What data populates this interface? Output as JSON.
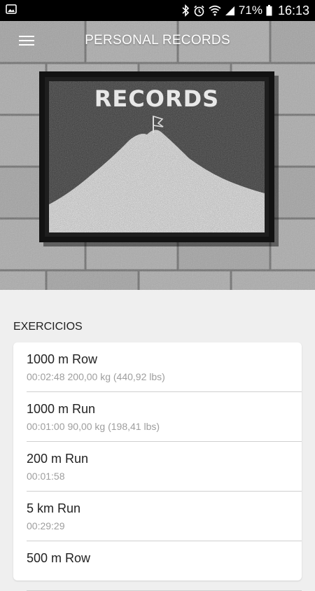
{
  "status_bar": {
    "battery": "71%",
    "time": "16:13",
    "icons": [
      "image-icon",
      "bluetooth-icon",
      "alarm-icon",
      "wifi-icon",
      "signal-icon",
      "battery-icon"
    ]
  },
  "app_bar": {
    "title": "PERSONAL RECORDS",
    "menu_icon": "hamburger-menu-icon"
  },
  "hero": {
    "board_text": "RECORDS"
  },
  "section": {
    "title": "EXERCICIOS"
  },
  "records": [
    {
      "name": "1000 m Row",
      "time": "00:02:48",
      "weight": "200,00 kg (440,92 lbs)"
    },
    {
      "name": "1000 m Run",
      "time": "00:01:00",
      "weight": "90,00 kg (198,41 lbs)"
    },
    {
      "name": "200 m Run",
      "time": "00:01:58",
      "weight": ""
    },
    {
      "name": "5 km Run",
      "time": "00:29:29",
      "weight": ""
    },
    {
      "name": "500 m Row",
      "time": "",
      "weight": ""
    }
  ],
  "colors": {
    "status_bar_bg": "#000000",
    "content_bg": "#efefef",
    "card_bg": "#ffffff",
    "primary_text": "#222222",
    "secondary_text": "#9e9e9e",
    "divider": "#cfcfcf"
  }
}
